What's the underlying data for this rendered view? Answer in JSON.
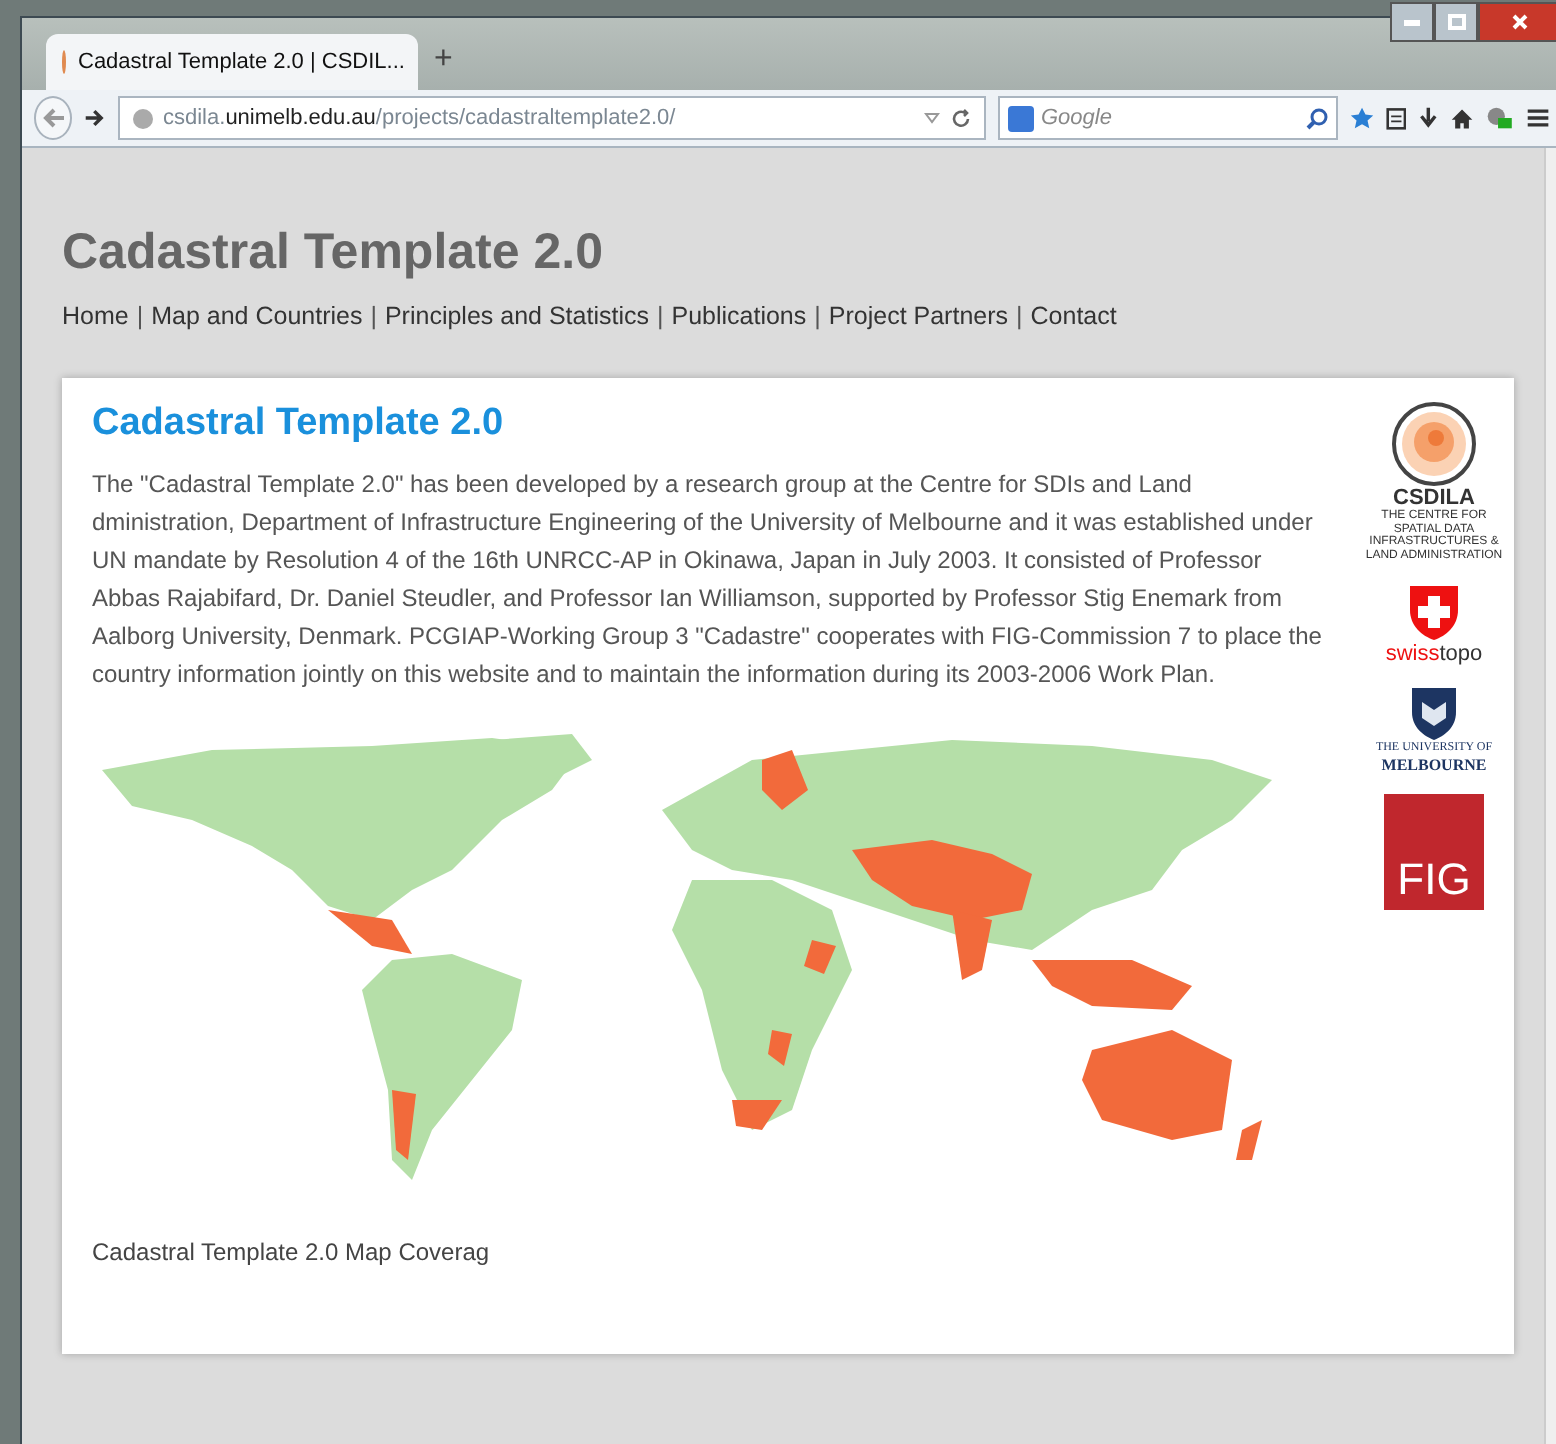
{
  "browser": {
    "tab_title": "Cadastral Template 2.0 | CSDIL...",
    "new_tab": "+",
    "url": "csdila.**unimelb.edu.au**/projects/cadastraltemplate2.0/",
    "search_placeholder": "Google"
  },
  "page": {
    "site_title": "Cadastral Template 2.0",
    "nav": [
      {
        "kind": "link",
        "label": "Home"
      },
      {
        "kind": "separator",
        "label": "|"
      },
      {
        "kind": "link",
        "label": "Map and Countries"
      },
      {
        "kind": "separator",
        "label": "|"
      },
      {
        "kind": "link",
        "label": "Principles and Statistics"
      },
      {
        "kind": "separator",
        "label": "|"
      },
      {
        "kind": "link",
        "label": "Publications"
      },
      {
        "kind": "separator",
        "label": "|"
      },
      {
        "kind": "link",
        "label": "Project Partners"
      },
      {
        "kind": "separator",
        "label": "|"
      },
      {
        "kind": "link",
        "label": "Contact"
      }
    ],
    "card": {
      "heading": "Cadastral Template 2.0",
      "paragraph": "The \"Cadastral Template 2.0\" has been developed by a research group at the Centre for SDIs and Land dministration, Department of Infrastructure Engineering of the University of Melbourne and it was established under UN mandate by Resolution 4 of the 16th UNRCC-AP in Okinawa, Japan in July 2003. It consisted of Professor Abbas Rajabifard, Dr. Daniel Steudler, and Professor Ian Williamson, supported by Professor Stig Enemark from Aalborg University, Denmark. PCGIAP-Working Group 3 \"Cadastre\" cooperates with FIG-Commission 7 to place the country information jointly on this website and to maintain the information during its 2003-2006 Work Plan.",
      "caption": "Cadastral Template 2.0 Map Coverag",
      "logos": [
        {
          "kind": "csdila",
          "title": "CSDILA",
          "subtitle": "THE CENTRE FOR SPATIAL DATA INFRASTRUCTURES & LAND ADMINISTRATION"
        },
        {
          "kind": "swisstopo",
          "title": "swiss",
          "subtitle": "topo"
        },
        {
          "kind": "melbourne",
          "title": "THE UNIVERSITY OF",
          "subtitle": "MELBOURNE"
        },
        {
          "kind": "fig",
          "title": "FIG"
        }
      ]
    }
  }
}
